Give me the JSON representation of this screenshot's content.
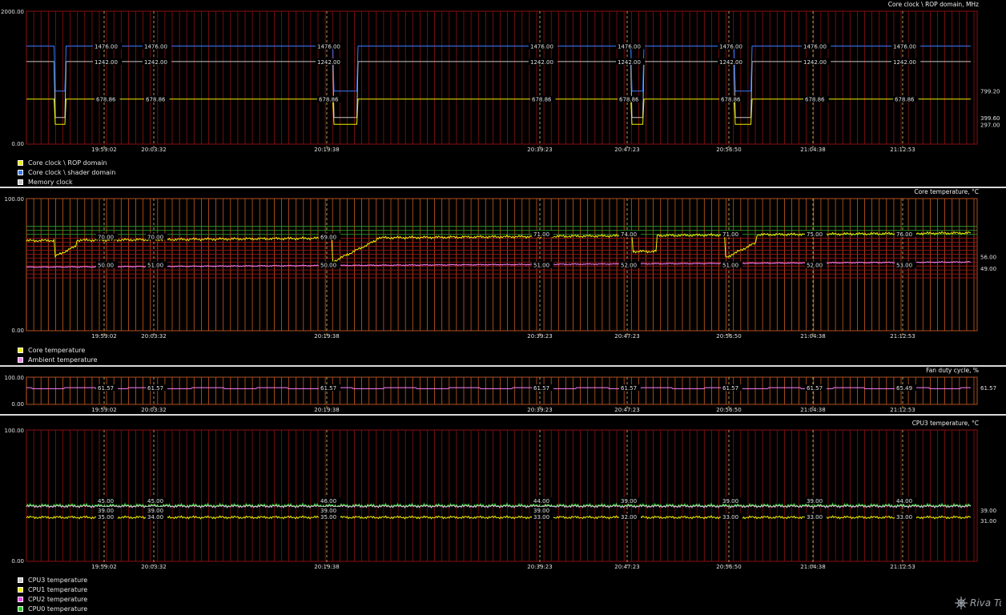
{
  "times": [
    "19:59:02",
    "20:03:32",
    "20:19:38",
    "20:39:23",
    "20:47:23",
    "20:56:50",
    "21:04:38",
    "21:12:53"
  ],
  "panels": [
    {
      "id": "clock",
      "title": "Core clock \\ ROP domain, MHz",
      "ymax": "2000.00",
      "ymin": "0.00",
      "ymax_value": 2000,
      "plot_style": "red",
      "values": {
        "shader_val": "1476.00",
        "memory_val": "1242.00",
        "rop_val": "678.86",
        "end_shader": "799.20",
        "end_rop": "399.60",
        "end_mem": "297.00"
      },
      "legend": [
        {
          "label": "Core clock \\ ROP domain",
          "color": "#f0f000"
        },
        {
          "label": "Core clock \\ shader domain",
          "color": "#3a78ff"
        },
        {
          "label": "Memory clock",
          "color": "#c8c8c8"
        }
      ]
    },
    {
      "id": "coretemp",
      "title": "Core temperature, °C",
      "ymax": "100.00",
      "ymin": "0.00",
      "ymax_value": 100,
      "plot_style": "orange",
      "values": {
        "core_labels": [
          "70.00",
          "70.00",
          "69.00",
          "71.00",
          "74.00",
          "71.00",
          "75.00",
          "76.00"
        ],
        "amb_labels": [
          "50.00",
          "51.00",
          "50.00",
          "51.00",
          "52.00",
          "51.00",
          "52.00",
          "53.00"
        ],
        "end_core": "56.00",
        "end_amb": "49.00"
      },
      "legend": [
        {
          "label": "Core temperature",
          "color": "#f0f000"
        },
        {
          "label": "Ambient temperature",
          "color": "#ff80ff"
        }
      ]
    },
    {
      "id": "fan",
      "title": "Fan duty cycle, %",
      "ymax": "100.00",
      "ymin": "0.00",
      "ymax_value": 100,
      "plot_style": "orange",
      "values": {
        "fan_labels": [
          "61.57",
          "61.57",
          "61.57",
          "61.57",
          "61.57",
          "61.57",
          "61.57",
          "65.49"
        ],
        "end_fan": "61.57"
      }
    },
    {
      "id": "cpu",
      "title": "CPU3 temperature, °C",
      "ymax": "100.00",
      "ymin": "0.00",
      "ymax_value": 100,
      "plot_style": "red",
      "values": {
        "top_labels": [
          "45.00",
          "45.00",
          "46.00",
          "44.00",
          "39.00",
          "39.00",
          "39.00",
          "44.00"
        ],
        "mid_labels": [
          "39.00",
          "39.00",
          "39.00",
          "39.00",
          "",
          "",
          "",
          ""
        ],
        "low_labels": [
          "35.00",
          "34.00",
          "35.00",
          "33.00",
          "32.00",
          "33.00",
          "33.00",
          "33.00"
        ],
        "end_top": "39.00",
        "end_low": "31.00"
      },
      "legend": [
        {
          "label": "CPU3 temperature",
          "color": "#c8c8c8"
        },
        {
          "label": "CPU1 temperature",
          "color": "#f0f000"
        },
        {
          "label": "CPU2 temperature",
          "color": "#ff3cff"
        },
        {
          "label": "CPU0 temperature",
          "color": "#20d020"
        }
      ]
    }
  ],
  "logo_text": "Riva Tuner"
}
